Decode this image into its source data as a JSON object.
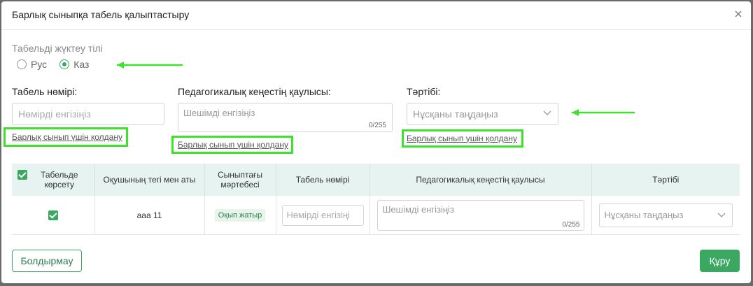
{
  "dialog": {
    "title": "Барлық сыныпқа табель қалыптастыру",
    "close_icon": "close-icon"
  },
  "language": {
    "label": "Табельді жүктеу тілі",
    "options": [
      {
        "label": "Рус",
        "selected": false
      },
      {
        "label": "Каз",
        "selected": true
      }
    ]
  },
  "form": {
    "tabel_number": {
      "label": "Табель нөмірі:",
      "placeholder": "Нөмірді енгізіңіз",
      "apply_link": "Барлық сынып үшін қолдану"
    },
    "council_decision": {
      "label": "Педагогикалық кеңестің қаулысы:",
      "placeholder": "Шешімді енгізіңіз",
      "counter": "0/255",
      "apply_link": "Барлық сынып үшін қолдану"
    },
    "order": {
      "label": "Тәртібі:",
      "placeholder": "Нұсқаны таңдаңыз",
      "apply_link": "Барлық сынып үшін қолдану"
    }
  },
  "table": {
    "headers": [
      "Табельде көрсету",
      "Оқушының тегі мен аты",
      "Сыныптағы мәртебесі",
      "Табель нөмірі",
      "Педагогикалық кеңестің қаулысы",
      "Тәртібі"
    ],
    "rows": [
      {
        "show": true,
        "name": "ааа 11",
        "status": "Оқып жатыр",
        "tabel_placeholder": "Нөмірді енгізіңі",
        "decision_placeholder": "Шешімді енгізіңіз",
        "decision_counter": "0/255",
        "order_placeholder": "Нұсқаны таңдаңыз"
      }
    ]
  },
  "footer": {
    "cancel_label": "Болдырмау",
    "create_label": "Құру"
  },
  "colors": {
    "accent": "#3aa860",
    "highlight": "#3ee12b",
    "table_header_bg": "#e6f3f1"
  }
}
